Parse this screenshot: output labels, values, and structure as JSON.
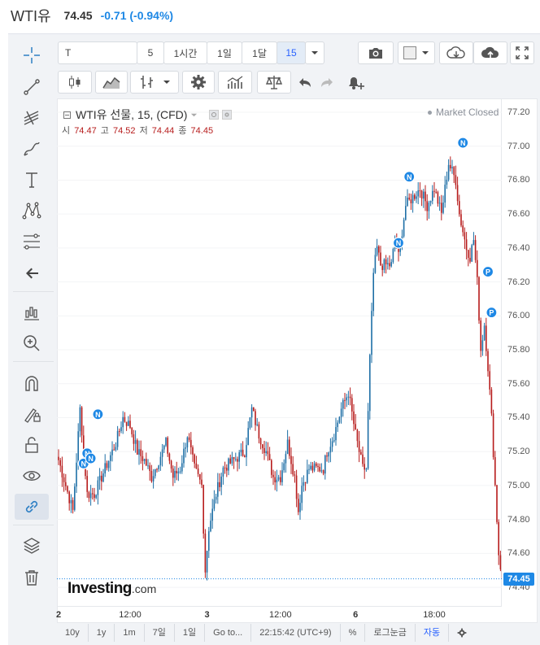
{
  "header": {
    "title": "WTI유",
    "last": "74.45",
    "change": "-0.71 (-0.94%)"
  },
  "toolbar": {
    "symbol": "T",
    "intervals": [
      "5",
      "1시간",
      "1일",
      "1달",
      "15"
    ],
    "selected_interval": "15"
  },
  "legend": {
    "title": "WTI유 선물, 15, (CFD)",
    "open_label": "시",
    "open": "74.47",
    "high_label": "고",
    "high": "74.52",
    "low_label": "저",
    "low": "74.44",
    "close_label": "종",
    "close": "74.45",
    "status": "Market Closed"
  },
  "branding": {
    "name": "Investing",
    "suffix": ".com"
  },
  "bottom_bar": {
    "ranges": [
      "10y",
      "1y",
      "1m",
      "7일",
      "1일",
      "Go to..."
    ],
    "clock": "22:15:42 (UTC+9)",
    "percent": "%",
    "log": "로그눈금",
    "auto": "자동"
  },
  "colors": {
    "up": "#1e6fa6",
    "down": "#b71c1c",
    "accent": "#1e88e5",
    "change": "#1e88e5"
  },
  "chart_data": {
    "type": "candlestick",
    "title": "WTI유 선물, 15, (CFD)",
    "ylim": [
      74.3,
      77.25
    ],
    "y_ticks": [
      77.2,
      77.0,
      76.8,
      76.6,
      76.4,
      76.2,
      76.0,
      75.8,
      75.6,
      75.4,
      75.2,
      75.0,
      74.8,
      74.6,
      74.4
    ],
    "x_ticks": [
      {
        "label": "2",
        "bold": true,
        "bar": 0
      },
      {
        "label": "12:00",
        "bold": false,
        "bar": 40
      },
      {
        "label": "3",
        "bold": true,
        "bar": 83
      },
      {
        "label": "12:00",
        "bold": false,
        "bar": 124
      },
      {
        "label": "6",
        "bold": true,
        "bar": 166
      },
      {
        "label": "18:00",
        "bold": false,
        "bar": 210
      }
    ],
    "last_price": 74.45,
    "anchors": [
      [
        0,
        75.15
      ],
      [
        4,
        75.0
      ],
      [
        8,
        74.85
      ],
      [
        12,
        75.45
      ],
      [
        16,
        74.95
      ],
      [
        20,
        74.95
      ],
      [
        26,
        75.1
      ],
      [
        32,
        75.25
      ],
      [
        36,
        75.4
      ],
      [
        40,
        75.35
      ],
      [
        44,
        75.2
      ],
      [
        48,
        75.15
      ],
      [
        52,
        75.05
      ],
      [
        56,
        75.15
      ],
      [
        60,
        75.25
      ],
      [
        64,
        75.05
      ],
      [
        68,
        75.1
      ],
      [
        72,
        75.3
      ],
      [
        76,
        75.1
      ],
      [
        80,
        75.0
      ],
      [
        82,
        74.5
      ],
      [
        84,
        74.75
      ],
      [
        88,
        74.95
      ],
      [
        92,
        75.1
      ],
      [
        98,
        75.15
      ],
      [
        104,
        75.2
      ],
      [
        108,
        75.45
      ],
      [
        112,
        75.3
      ],
      [
        116,
        75.2
      ],
      [
        120,
        75.05
      ],
      [
        124,
        75.05
      ],
      [
        128,
        75.25
      ],
      [
        132,
        75.05
      ],
      [
        134,
        74.85
      ],
      [
        136,
        75.0
      ],
      [
        140,
        75.1
      ],
      [
        144,
        75.1
      ],
      [
        148,
        75.1
      ],
      [
        150,
        75.2
      ],
      [
        154,
        75.3
      ],
      [
        158,
        75.45
      ],
      [
        162,
        75.55
      ],
      [
        166,
        75.3
      ],
      [
        168,
        75.2
      ],
      [
        170,
        75.1
      ],
      [
        172,
        75.1
      ],
      [
        174,
        75.75
      ],
      [
        176,
        76.25
      ],
      [
        178,
        76.4
      ],
      [
        180,
        76.3
      ],
      [
        184,
        76.3
      ],
      [
        186,
        76.3
      ],
      [
        188,
        76.45
      ],
      [
        190,
        76.35
      ],
      [
        194,
        76.65
      ],
      [
        198,
        76.7
      ],
      [
        202,
        76.75
      ],
      [
        206,
        76.65
      ],
      [
        210,
        76.75
      ],
      [
        214,
        76.6
      ],
      [
        216,
        76.75
      ],
      [
        218,
        76.9
      ],
      [
        220,
        76.85
      ],
      [
        222,
        76.8
      ],
      [
        224,
        76.6
      ],
      [
        226,
        76.5
      ],
      [
        228,
        76.4
      ],
      [
        230,
        76.35
      ],
      [
        232,
        76.45
      ],
      [
        234,
        76.2
      ],
      [
        236,
        75.8
      ],
      [
        238,
        75.95
      ],
      [
        240,
        75.7
      ],
      [
        242,
        75.4
      ],
      [
        244,
        75.0
      ],
      [
        246,
        74.6
      ],
      [
        248,
        74.45
      ]
    ],
    "markers": [
      {
        "label": "N",
        "bar": 14,
        "price": 75.13
      },
      {
        "label": "N",
        "bar": 16,
        "price": 75.19
      },
      {
        "label": "N",
        "bar": 18,
        "price": 75.16
      },
      {
        "label": "N",
        "bar": 22,
        "price": 75.42
      },
      {
        "label": "N",
        "bar": 190,
        "price": 76.43
      },
      {
        "label": "N",
        "bar": 196,
        "price": 76.82
      },
      {
        "label": "N",
        "bar": 226,
        "price": 77.02
      },
      {
        "label": "P",
        "bar": 240,
        "price": 76.26
      },
      {
        "label": "P",
        "bar": 242,
        "price": 76.02
      }
    ]
  }
}
